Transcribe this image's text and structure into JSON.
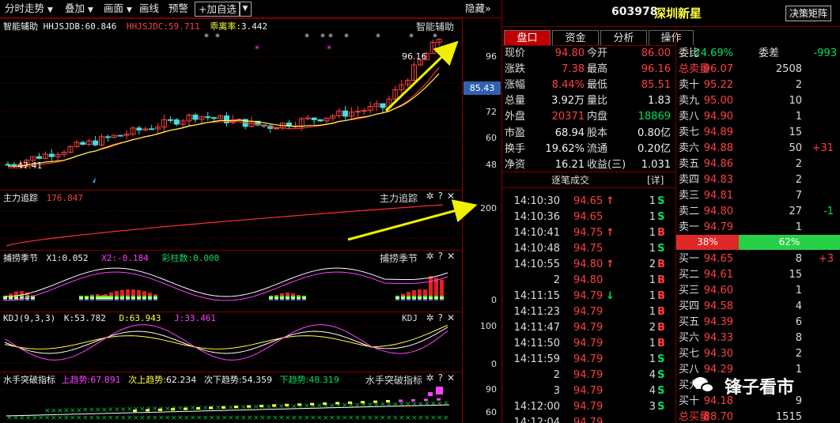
{
  "toolbar": {
    "timeshare": "分时走势",
    "add": "叠加",
    "draw": "画面",
    "drawline": "画线",
    "alert": "预警",
    "add_watch": "+加自选",
    "hide": "隐藏"
  },
  "stock": {
    "code": "603978",
    "name": "深圳新星",
    "matrix_btn": "决策矩阵"
  },
  "tabs": [
    "盘口",
    "资金",
    "分析",
    "操作"
  ],
  "main_chart": {
    "title": "智能辅助",
    "ind1_label": "HHJSJDB:",
    "ind1_value": "60.846",
    "ind2_label": "HHJSJDC:",
    "ind2_value": "59.711",
    "ind3_label": "乖离率:",
    "ind3_value": "3.442",
    "high_label": "96.16",
    "low_label": "47.41",
    "axis": [
      "96",
      "84",
      "72",
      "60",
      "48"
    ],
    "current_price": "85.43"
  },
  "panel2": {
    "title": "主力追踪",
    "value": "176.847",
    "axis": [
      "200"
    ]
  },
  "panel3": {
    "title": "捕捞季节",
    "x1": "X1:0.052",
    "x2": "X2:-0.184",
    "x3": "彩柱数:0.000",
    "axis": [
      "0"
    ]
  },
  "panel4": {
    "title": "KDJ",
    "params": "KDJ(9,3,3)",
    "k": "K:53.782",
    "d": "D:63.943",
    "j": "J:33.461",
    "axis": [
      "100",
      "0"
    ]
  },
  "panel5": {
    "title": "水手突破指标",
    "up_label": "上趋势:",
    "up_value": "67.891",
    "next_label": "次上趋势:",
    "next_value": "62.234",
    "sub_label": "次下趋势:",
    "sub_value": "54.359",
    "down_label": "下趋势:",
    "down_value": "48.319",
    "axis": [
      "90",
      "60"
    ]
  },
  "quote": [
    {
      "l1": "现价",
      "v1": "94.80",
      "c1": "red",
      "l2": "今开",
      "v2": "86.00",
      "c2": "red"
    },
    {
      "l1": "涨跌",
      "v1": "7.38",
      "c1": "red",
      "l2": "最高",
      "v2": "96.16",
      "c2": "red"
    },
    {
      "l1": "涨幅",
      "v1": "8.44%",
      "c1": "red",
      "l2": "最低",
      "v2": "85.51",
      "c2": "red"
    },
    {
      "l1": "总量",
      "v1": "3.92万",
      "c1": "wht",
      "l2": "量比",
      "v2": "1.83",
      "c2": "wht"
    },
    {
      "l1": "外盘",
      "v1": "20371",
      "c1": "red",
      "l2": "内盘",
      "v2": "18869",
      "c2": "grn"
    },
    {
      "l1": "市盈",
      "v1": "68.94",
      "c1": "wht",
      "l2": "股本",
      "v2": "0.80亿",
      "c2": "wht"
    },
    {
      "l1": "换手",
      "v1": "19.62%",
      "c1": "wht",
      "l2": "流通",
      "v2": "0.20亿",
      "c2": "wht"
    },
    {
      "l1": "净资",
      "v1": "16.21",
      "c1": "wht",
      "l2": "收益(三)",
      "v2": "1.031",
      "c2": "wht"
    }
  ],
  "ticks_title": "逐笔成交",
  "ticks_detail": "[详]",
  "ticks": [
    {
      "t": "14:10:30",
      "p": "94.65",
      "arrow": "↑",
      "ac": "red",
      "v": "1",
      "s": "S",
      "sc": "grn"
    },
    {
      "t": "14:10:36",
      "p": "94.65",
      "arrow": "",
      "ac": "red",
      "v": "1",
      "s": "S",
      "sc": "grn"
    },
    {
      "t": "14:10:41",
      "p": "94.75",
      "arrow": "↑",
      "ac": "red",
      "v": "1",
      "s": "B",
      "sc": "red"
    },
    {
      "t": "14:10:48",
      "p": "94.75",
      "arrow": "",
      "ac": "red",
      "v": "1",
      "s": "S",
      "sc": "grn"
    },
    {
      "t": "14:10:55",
      "p": "94.80",
      "arrow": "↑",
      "ac": "red",
      "v": "2",
      "s": "B",
      "sc": "red"
    },
    {
      "t": "2",
      "p": "94.80",
      "arrow": "",
      "ac": "red",
      "v": "1",
      "s": "B",
      "sc": "red"
    },
    {
      "t": "14:11:15",
      "p": "94.79",
      "arrow": "↓",
      "ac": "grn",
      "v": "1",
      "s": "B",
      "sc": "red"
    },
    {
      "t": "14:11:23",
      "p": "94.79",
      "arrow": "",
      "ac": "red",
      "v": "1",
      "s": "B",
      "sc": "red"
    },
    {
      "t": "14:11:47",
      "p": "94.79",
      "arrow": "",
      "ac": "red",
      "v": "2",
      "s": "B",
      "sc": "red"
    },
    {
      "t": "14:11:50",
      "p": "94.79",
      "arrow": "",
      "ac": "red",
      "v": "1",
      "s": "B",
      "sc": "red"
    },
    {
      "t": "14:11:59",
      "p": "94.79",
      "arrow": "",
      "ac": "red",
      "v": "1",
      "s": "S",
      "sc": "grn"
    },
    {
      "t": "2",
      "p": "94.79",
      "arrow": "",
      "ac": "red",
      "v": "4",
      "s": "S",
      "sc": "grn"
    },
    {
      "t": "3",
      "p": "94.79",
      "arrow": "",
      "ac": "red",
      "v": "4",
      "s": "S",
      "sc": "grn"
    },
    {
      "t": "14:12:00",
      "p": "94.79",
      "arrow": "",
      "ac": "red",
      "v": "3",
      "s": "S",
      "sc": "grn"
    },
    {
      "t": "14:12:04",
      "p": "94.79",
      "arrow": "",
      "ac": "red",
      "v": "",
      "s": "",
      "sc": "grn"
    }
  ],
  "book": {
    "weibi_label": "委比",
    "weibi_value": "-24.69%",
    "weicha_label": "委差",
    "weicha_value": "-993",
    "sell_total_label": "总卖量",
    "sell_total_price": "96.07",
    "sell_total_vol": "2508",
    "sells": [
      {
        "l": "卖十",
        "p": "95.22",
        "v": "2",
        "chg": ""
      },
      {
        "l": "卖九",
        "p": "95.00",
        "v": "10",
        "chg": ""
      },
      {
        "l": "卖八",
        "p": "94.90",
        "v": "1",
        "chg": ""
      },
      {
        "l": "卖七",
        "p": "94.89",
        "v": "15",
        "chg": ""
      },
      {
        "l": "卖六",
        "p": "94.88",
        "v": "50",
        "chg": "+31"
      },
      {
        "l": "卖五",
        "p": "94.86",
        "v": "2",
        "chg": ""
      },
      {
        "l": "卖四",
        "p": "94.83",
        "v": "2",
        "chg": ""
      },
      {
        "l": "卖三",
        "p": "94.81",
        "v": "7",
        "chg": ""
      },
      {
        "l": "卖二",
        "p": "94.80",
        "v": "27",
        "chg": "-1"
      },
      {
        "l": "卖一",
        "p": "94.79",
        "v": "1",
        "chg": ""
      }
    ],
    "ratio_buy": "38%",
    "ratio_sell": "62%",
    "ratio_buy_frac": 0.38,
    "buys": [
      {
        "l": "买一",
        "p": "94.65",
        "v": "8",
        "chg": "+3"
      },
      {
        "l": "买二",
        "p": "94.61",
        "v": "15",
        "chg": ""
      },
      {
        "l": "买三",
        "p": "94.60",
        "v": "1",
        "chg": ""
      },
      {
        "l": "买四",
        "p": "94.58",
        "v": "4",
        "chg": ""
      },
      {
        "l": "买五",
        "p": "94.39",
        "v": "6",
        "chg": ""
      },
      {
        "l": "买六",
        "p": "94.33",
        "v": "8",
        "chg": ""
      },
      {
        "l": "买七",
        "p": "94.30",
        "v": "2",
        "chg": ""
      },
      {
        "l": "买八",
        "p": "94.29",
        "v": "1",
        "chg": ""
      },
      {
        "l": "买九",
        "p": "",
        "v": "",
        "chg": ""
      },
      {
        "l": "买十",
        "p": "94.18",
        "v": "9",
        "chg": ""
      }
    ],
    "buy_total_label": "总买量",
    "buy_total_price": "88.70",
    "buy_total_vol": "1515"
  },
  "watermark": "锋子看市"
}
